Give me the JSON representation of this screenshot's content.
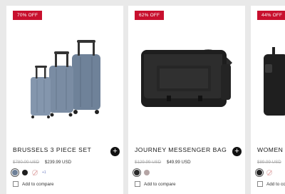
{
  "products": [
    {
      "badge": "70% OFF",
      "title": "BRUSSELS 3 PIECE SET",
      "old_price": "$780.00 USD",
      "price": "$239.99 USD",
      "swatches": [
        "#6d7f97",
        "#1f1f1f",
        "x"
      ],
      "more": "+1"
    },
    {
      "badge": "62% OFF",
      "title": "JOURNEY MESSENGER BAG",
      "old_price": "$129.99 USD",
      "price": "$49.99 USD",
      "swatches": [
        "#2a2a2a",
        "#b5a5a5"
      ]
    },
    {
      "badge": "44% OFF",
      "title": "WOMEN W",
      "old_price": "$89.99 USD",
      "price": "",
      "swatches": [
        "#222222",
        "x"
      ]
    }
  ],
  "compare_label": "Add to compare",
  "add_icon": "plus-icon",
  "colors": {
    "badge": "#c8102e",
    "button": "#111111"
  }
}
